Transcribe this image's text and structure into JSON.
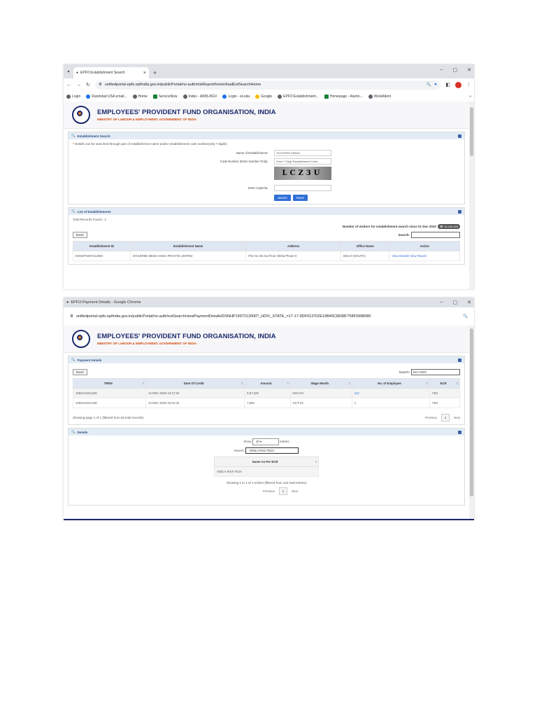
{
  "window1": {
    "tab_title": "EPFO:Establishment Search",
    "url": "unifiedportal-epfo.epfindia.gov.in/publicPortal/no-auth/misReport/home/loadEstSearchHome",
    "bookmarks": [
      "Login",
      "Randstad USA email...",
      "Home",
      "ServiceNow",
      "Index - AIMS-BGV",
      "Login - eLoda",
      "Google",
      "EPFO:Establishment...",
      "Homepage - Alumn...",
      "WorkAtlent"
    ],
    "org_name": "EMPLOYEES' PROVIDENT FUND ORGANISATION, INDIA",
    "ministry": "MINISTRY OF LABOUR & EMPLOYMENT, GOVERNMENT OF INDIA",
    "search_panel": {
      "title": "Establishment Search",
      "note": "Details can be searched through part of establishment name and/or establishment code number(only 7 digits)",
      "name_label": "Name of Establishment:",
      "name_value": "DOCEREE MEDIA",
      "code_label": "Code Number (Enter Number Only):",
      "code_placeholder": "Enter 7 Digit Establishment Code",
      "captcha_text": "LCZ3U",
      "captcha_label": "Enter Captcha:",
      "search_btn": "Search",
      "reset_btn": "Reset"
    },
    "list_panel": {
      "title": "List of Establishments",
      "total": "Total Records Found : 1",
      "visitors": "Number of visitors for establishment search since 01 Dec 2023",
      "visitor_count": "16,245,485",
      "excel_btn": "Excel",
      "search_label": "Search:",
      "columns": [
        "Establishment ID",
        "Establishment Name",
        "Address",
        "Office Name",
        "Action"
      ],
      "rows": [
        {
          "id": "DSNHP1997212000",
          "name": "DOCEREE MEDIA INDIA PRIVATE LIMITED",
          "address": "Plot No 38 2nd Floor Okhla Phase-3",
          "office": "DELHI (SOUTH)",
          "action": "View Details/ View Report"
        }
      ]
    }
  },
  "window2": {
    "title": "EPFO:Payment Details - Google Chrome",
    "url": "unifiedportal-epfo.epfindia.gov.in/publicPortal/no-auth/estSearch/viewPaymentDetails/DSNHP1997212000?_HDIV_STATE_=17-17-9DF013702E19B45C8938F758F5998080",
    "org_name": "EMPLOYEES' PROVIDENT FUND ORGANISATION, INDIA",
    "ministry": "MINISTRY OF LABOUR & EMPLOYMENT, GOVERNMENT OF INDIA",
    "payment_panel": {
      "title": "Payment Details",
      "excel_btn": "Excel",
      "search_label": "Search:",
      "search_value": "Dec-2023",
      "columns": [
        "TRRN",
        "Date Of Credit",
        "Amount",
        "Wage Month",
        "No. of Employee",
        "ECR"
      ],
      "rows": [
        {
          "trrn": "1052312011400",
          "date": "14-DEC-2023 15:17:53",
          "amount": "8,67,320",
          "wage": "NOV-23",
          "emp": "113",
          "ecr": "YES"
        },
        {
          "trrn": "1052312011430",
          "date": "14-DEC-2023 15:01:42",
          "amount": "7,892",
          "wage": "OCT-23",
          "emp": "1",
          "ecr": "YES"
        }
      ],
      "showing": "Showing page 1 of 1 (filtered from 63 total records)",
      "prev": "Previous",
      "page": "1",
      "next": "Next"
    },
    "details_panel": {
      "title": "Details",
      "show": "Show",
      "entries_value": "10",
      "entries": "entries",
      "search_label": "Search:",
      "search_value": "VIDILA RAVI TEJA",
      "column": "Name As Per ECR",
      "row": "VIDILA RAVI TEJA",
      "showing": "Showing 1 to 1 of 1 entries (filtered from 113 total entries)",
      "prev": "Previous",
      "page": "1",
      "next": "Next"
    }
  }
}
